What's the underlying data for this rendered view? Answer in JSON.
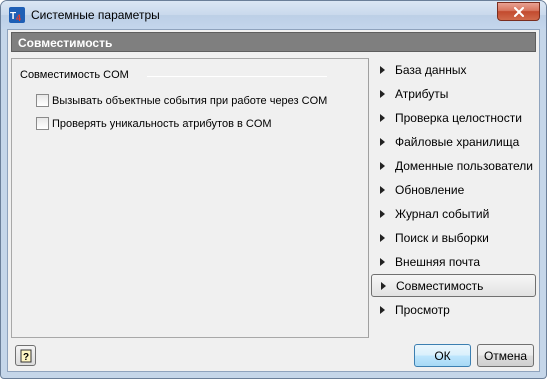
{
  "window": {
    "title": "Системные параметры"
  },
  "header": {
    "title": "Совместимость"
  },
  "group": {
    "title": "Совместимость COM",
    "options": [
      {
        "label": "Вызывать объектные события при работе через COM",
        "checked": false
      },
      {
        "label": "Проверять уникальность атрибутов в COM",
        "checked": false
      }
    ]
  },
  "nav": {
    "items": [
      {
        "label": "База данных"
      },
      {
        "label": "Атрибуты"
      },
      {
        "label": "Проверка целостности"
      },
      {
        "label": "Файловые хранилища"
      },
      {
        "label": "Доменные пользователи"
      },
      {
        "label": "Обновление"
      },
      {
        "label": "Журнал событий"
      },
      {
        "label": "Поиск и выборки"
      },
      {
        "label": "Внешняя почта"
      },
      {
        "label": "Совместимость",
        "selected": true
      },
      {
        "label": "Просмотр"
      }
    ]
  },
  "buttons": {
    "ok": "ОК",
    "cancel": "Отмена",
    "help_icon": "help-icon"
  },
  "colors": {
    "header_bg": "#7f7f7f",
    "window_frame": "#c5d6e9",
    "close_red": "#c24a2e"
  }
}
